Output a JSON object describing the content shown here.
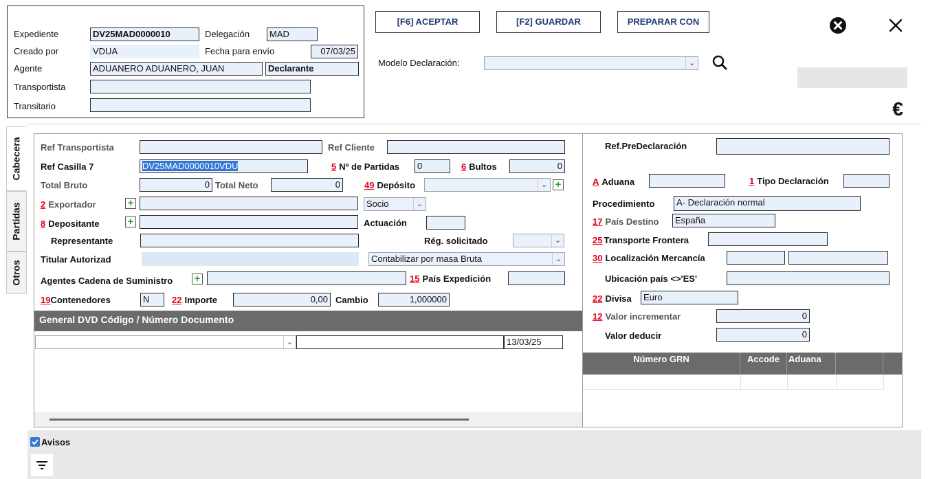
{
  "header": {
    "expediente_label": "Expediente",
    "expediente_value": "DV25MAD0000010",
    "delegacion_label": "Delegación",
    "delegacion_value": "MAD",
    "creado_por_label": "Creado por",
    "creado_por_value": "VDUA",
    "fecha_envio_label": "Fecha para envío",
    "fecha_envio_value": "07/03/25",
    "agente_label": "Agente",
    "agente_value": "ADUANERO ADUANERO, JUAN",
    "declarante_value": "Declarante",
    "transportista_label": "Transportista",
    "transportista_value": "",
    "transitario_label": "Transitario",
    "transitario_value": ""
  },
  "toolbar": {
    "aceptar_label": "[F6] ACEPTAR",
    "guardar_label": "[F2] GUARDAR",
    "preparar_label": "PREPARAR CON",
    "modelo_label": "Modelo Declaración:",
    "modelo_value": ""
  },
  "tabs": [
    "Cabecera",
    "Partidas",
    "Otros"
  ],
  "cabecera": {
    "ref_transportista_label": "Ref Transportista",
    "ref_transportista_value": "",
    "ref_cliente_label": "Ref Cliente",
    "ref_cliente_value": "",
    "ref_casilla7_label": "Ref Casilla 7",
    "ref_casilla7_value": "DV25MAD0000010VDU",
    "num_partidas_num": "5",
    "num_partidas_label": "Nº de Partidas",
    "num_partidas_value": "0",
    "bultos_num": "6",
    "bultos_label": "Bultos",
    "bultos_value": "0",
    "total_bruto_label": "Total Bruto",
    "total_bruto_value": "0",
    "total_neto_label": "Total Neto",
    "total_neto_value": "0",
    "deposito_num": "49",
    "deposito_label": "Depósito",
    "deposito_value": "",
    "exportador_num": "2",
    "exportador_label": "Exportador",
    "exportador_value": "",
    "socio_value": "Socio",
    "depositante_num": "8",
    "depositante_label": "Depositante",
    "depositante_value": "",
    "actuacion_label": "Actuación",
    "actuacion_value": "",
    "representante_label": "Representante",
    "representante_value": "",
    "reg_solicitado_label": "Rég. solicitado",
    "reg_solicitado_value": "",
    "titular_label": "Titular Autorizad",
    "titular_value": "",
    "contabilizar_value": "Contabilizar por masa Bruta",
    "agentes_label": "Agentes Cadena de Suministro",
    "agentes_value": "",
    "pais_expedicion_num": "15",
    "pais_expedicion_label": "País Expedición",
    "pais_expedicion_value": "",
    "contenedores_num": "19",
    "contenedores_label": "Contenedores",
    "contenedores_value": "N",
    "importe_num": "22",
    "importe_label": "Importe",
    "importe_value": "0,00",
    "cambio_label": "Cambio",
    "cambio_value": "1,000000"
  },
  "documentos": {
    "header": "General DVD Código / Número  Documento",
    "row_code": "",
    "row_number": "",
    "row_date": "13/03/25"
  },
  "right": {
    "ref_predeclaracion_label": "Ref.PreDeclaración",
    "ref_predeclaracion_value": "",
    "aduana_num": "A",
    "aduana_label": "Aduana",
    "aduana_value": "",
    "tipo_declaracion_num": "1",
    "tipo_declaracion_label": "Tipo Declaración",
    "tipo_declaracion_value": "",
    "procedimiento_label": "Procedimiento",
    "procedimiento_value": "A- Declaración normal",
    "pais_destino_num": "17",
    "pais_destino_label": "País Destino",
    "pais_destino_value": "España",
    "transporte_num": "25",
    "transporte_label": "Transporte Frontera",
    "transporte_value": "",
    "localizacion_num": "30",
    "localizacion_label": "Localización Mercancía",
    "localizacion_value1": "",
    "localizacion_value2": "",
    "ubicacion_label": "Ubicación país <>'ES'",
    "ubicacion_value": "",
    "divisa_num": "22",
    "divisa_label": "Divisa",
    "divisa_value": "Euro",
    "valor_incrementar_num": "12",
    "valor_incrementar_label": "Valor incrementar",
    "valor_incrementar_value": "0",
    "valor_deducir_label": "Valor deducir",
    "valor_deducir_value": "0",
    "grn_columns": [
      "Número GRN",
      "Accode",
      "Aduana"
    ]
  },
  "footer": {
    "avisos_label": "Avisos",
    "avisos_checked": true
  },
  "colors": {
    "field_bg": "#e8f0fb",
    "selection": "#3478d4",
    "required_red": "#e0001b",
    "table_header": "#6b6b6b",
    "bottom_panel": "#e8e8e8"
  }
}
